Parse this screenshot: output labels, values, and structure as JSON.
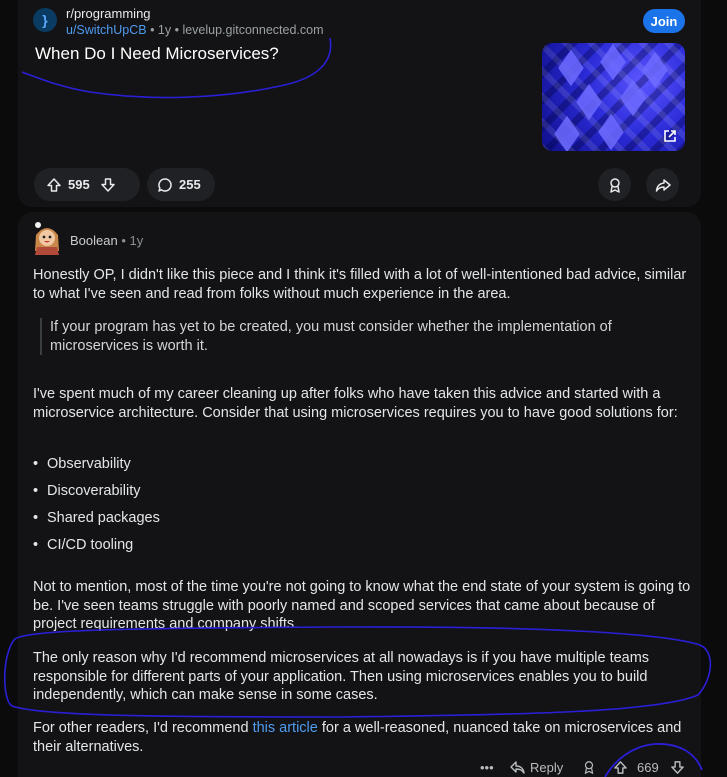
{
  "post": {
    "subreddit": "r/programming",
    "author": "u/SwitchUpCB",
    "meta_rest": " • 1y • levelup.gitconnected.com",
    "title": "When Do I Need Microservices?",
    "join_label": "Join",
    "subreddit_icon_glyph": "}",
    "upvotes": "595",
    "comments": "255",
    "colors": {
      "accent": "#1a73e8",
      "link": "#4f9bf0",
      "card": "#131315"
    }
  },
  "comment": {
    "author": "Boolean",
    "age": " • 1y",
    "para1": "Honestly OP, I didn't like this piece and I think it's filled with a lot of well-intentioned bad advice, similar to what I've seen and read from folks without much experience in the area.",
    "quote": "If your program has yet to be created, you must consider whether the implementation of microservices is worth it.",
    "para2": "I've spent much of my career cleaning up after folks who have taken this advice and started with a microservice architecture. Consider that using microservices requires you to have good solutions for:",
    "bullets": [
      "Observability",
      "Discoverability",
      "Shared packages",
      "CI/CD tooling"
    ],
    "para3": "Not to mention, most of the time you're not going to know what the end state of your system is going to be. I've seen teams struggle with poorly named and scoped services that came about because of project requirements and company shifts.",
    "para4": "The only reason why I'd recommend microservices at all nowadays is if you have multiple teams responsible for different parts of your application. Then using microservices enables you to build independently, which can make sense in some cases.",
    "para5_before": "For other readers, I'd recommend ",
    "para5_link": "this article",
    "para5_after": " for a well-reasoned, nuanced take on microservices and their alternatives.",
    "more_glyph": "•••",
    "reply_label": "Reply",
    "score": "669"
  },
  "icons": [
    "upvote-icon",
    "downvote-icon",
    "comment-icon",
    "award-icon",
    "share-icon",
    "external-link-icon",
    "reply-icon",
    "more-icon"
  ]
}
